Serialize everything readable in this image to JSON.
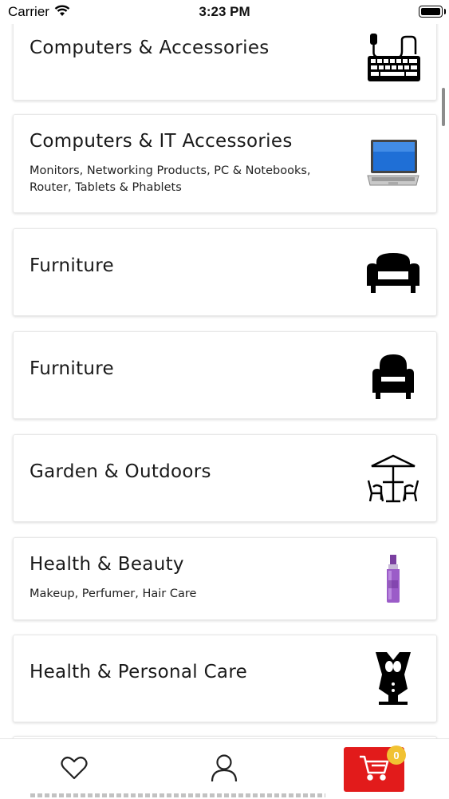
{
  "status_bar": {
    "carrier": "Carrier",
    "time": "3:23 PM"
  },
  "categories": [
    {
      "title": "Computers & Accessories",
      "subtitle": "",
      "icon": "keyboard-mouse-icon"
    },
    {
      "title": "Computers & IT Accessories",
      "subtitle": "Monitors, Networking Products, PC & Notebooks, Router, Tablets & Phablets",
      "icon": "laptop-icon"
    },
    {
      "title": "Furniture",
      "subtitle": "",
      "icon": "armchair-icon"
    },
    {
      "title": "Furniture",
      "subtitle": "",
      "icon": "chair-icon"
    },
    {
      "title": "Garden & Outdoors",
      "subtitle": "",
      "icon": "patio-table-icon"
    },
    {
      "title": "Health & Beauty",
      "subtitle": "Makeup, Perfumer, Hair Care",
      "icon": "perfume-bottle-icon"
    },
    {
      "title": "Health & Personal Care",
      "subtitle": "",
      "icon": "personal-care-icon"
    }
  ],
  "tab_bar": {
    "cart_count": "0",
    "cart_color": "#e21b1b",
    "badge_color": "#f1c232"
  }
}
